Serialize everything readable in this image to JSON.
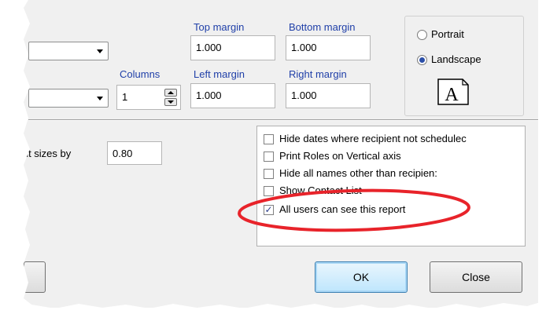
{
  "columns": {
    "label": "Columns",
    "value": "1"
  },
  "margins": {
    "top": {
      "label": "Top margin",
      "value": "1.000"
    },
    "bottom": {
      "label": "Bottom margin",
      "value": "1.000"
    },
    "left": {
      "label": "Left margin",
      "value": "1.000"
    },
    "right": {
      "label": "Right margin",
      "value": "1.000"
    }
  },
  "orientation": {
    "portrait_label": "Portrait",
    "landscape_label": "Landscape",
    "selected": "Landscape",
    "page_icon_letter": "A"
  },
  "font_scale": {
    "label": "font sizes by",
    "value": "0.80"
  },
  "options": [
    {
      "label": "Hide dates where recipient not schedulec",
      "checked": false
    },
    {
      "label": "Print Roles on Vertical axis",
      "checked": false
    },
    {
      "label": "Hide all names other than recipien:",
      "checked": false
    },
    {
      "label": "Show Contact List",
      "checked": false
    },
    {
      "label": "All users can see this report",
      "checked": true
    }
  ],
  "buttons": {
    "ok": "OK",
    "close": "Close"
  },
  "annotation_color": "#e8232a",
  "label_color": "#1f3fa8"
}
